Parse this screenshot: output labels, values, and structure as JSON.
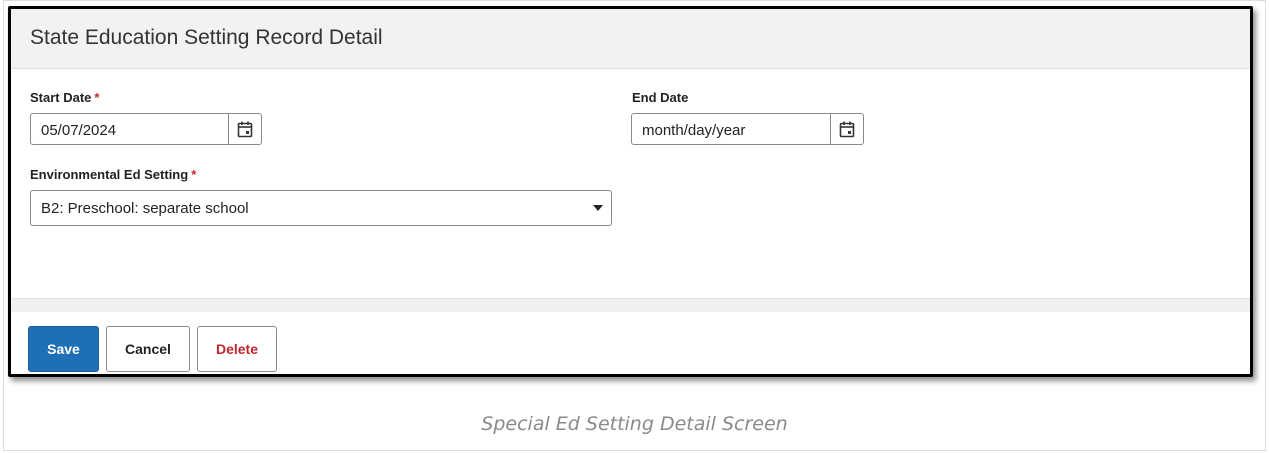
{
  "panel": {
    "title": "State Education Setting Record Detail"
  },
  "fields": {
    "start_date": {
      "label": "Start Date",
      "required_mark": "*",
      "value": "05/07/2024"
    },
    "end_date": {
      "label": "End Date",
      "placeholder": "month/day/year"
    },
    "env_ed_setting": {
      "label": "Environmental Ed Setting",
      "required_mark": "*",
      "selected": "B2: Preschool: separate school"
    }
  },
  "buttons": {
    "save": "Save",
    "cancel": "Cancel",
    "delete": "Delete"
  },
  "caption": "Special Ed Setting Detail Screen",
  "colors": {
    "primary": "#1f6fb5",
    "required": "#c0282d",
    "delete_text": "#c0282d"
  },
  "icons": {
    "calendar": "calendar-icon",
    "dropdown": "chevron-down-icon"
  }
}
